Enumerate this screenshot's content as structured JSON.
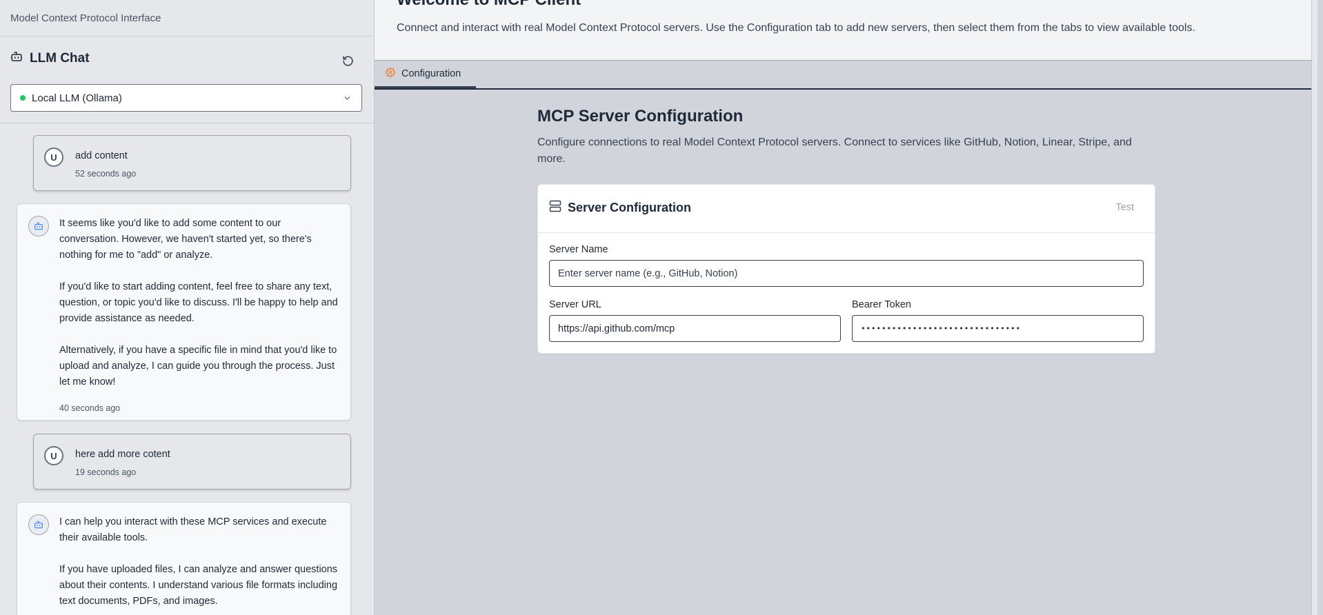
{
  "app_title": "Model Context Protocol Interface",
  "chat": {
    "title": "LLM Chat",
    "refresh_icon": "refresh-icon",
    "model_select": {
      "value": "Local LLM (Ollama)",
      "status_color": "#22c55e"
    },
    "messages": [
      {
        "role": "user",
        "avatar": "U",
        "text": "add content",
        "time": "52 seconds ago"
      },
      {
        "role": "assistant",
        "paragraphs": [
          "It seems like you'd like to add some content to our conversation. However, we haven't started yet, so there's nothing for me to \"add\" or analyze.",
          "If you'd like to start adding content, feel free to share any text, question, or topic you'd like to discuss. I'll be happy to help and provide assistance as needed.",
          "Alternatively, if you have a specific file in mind that you'd like to upload and analyze, I can guide you through the process. Just let me know!"
        ],
        "time": "40 seconds ago"
      },
      {
        "role": "user",
        "avatar": "U",
        "text": "here add more cotent",
        "time": "19 seconds ago"
      },
      {
        "role": "assistant",
        "paragraphs": [
          "I can help you interact with these MCP services and execute their available tools.",
          "If you have uploaded files, I can analyze and answer questions about their contents. I understand various file formats including text documents, PDFs, and images."
        ]
      }
    ]
  },
  "main": {
    "welcome_title": "Welcome to MCP Client",
    "welcome_desc": "Connect and interact with real Model Context Protocol servers. Use the Configuration tab to add new servers, then select them from the tabs to view available tools.",
    "tabs": [
      {
        "label": "Configuration",
        "icon": "gear-icon",
        "active": true,
        "accent": "#f97316"
      }
    ],
    "config": {
      "title": "MCP Server Configuration",
      "desc": "Configure connections to real Model Context Protocol servers. Connect to services like GitHub, Notion, Linear, Stripe, and more.",
      "card_title": "Server Configuration",
      "test_label": "Test",
      "server_name_label": "Server Name",
      "server_name_placeholder": "Enter server name (e.g., GitHub, Notion)",
      "server_url_label": "Server URL",
      "server_url_value": "https://api.github.com/mcp",
      "bearer_token_label": "Bearer Token",
      "bearer_token_masked": "•••••••••••••••••••••••••••••••"
    }
  }
}
